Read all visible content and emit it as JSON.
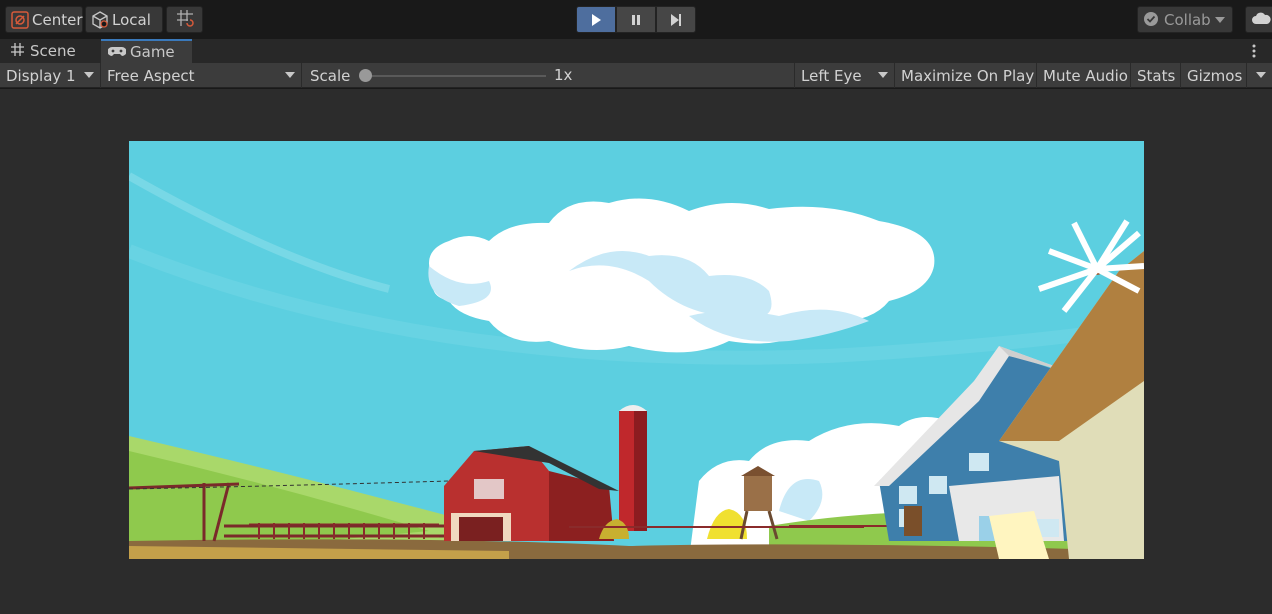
{
  "toolbar": {
    "pivot_label": "Center",
    "space_label": "Local",
    "collab_label": "Collab"
  },
  "tabs": [
    {
      "label": "Scene",
      "icon": "grid-icon"
    },
    {
      "label": "Game",
      "icon": "gamepad-icon"
    }
  ],
  "game_toolbar": {
    "display": "Display 1",
    "aspect": "Free Aspect",
    "scale_label": "Scale",
    "scale_value": "1x",
    "eye": "Left Eye",
    "maximize": "Maximize On Play",
    "mute": "Mute Audio",
    "stats": "Stats",
    "gizmos": "Gizmos"
  },
  "colors": {
    "accent": "#3a79bb",
    "play_active": "#4e6e9e",
    "sky": "#5ccfe0"
  }
}
